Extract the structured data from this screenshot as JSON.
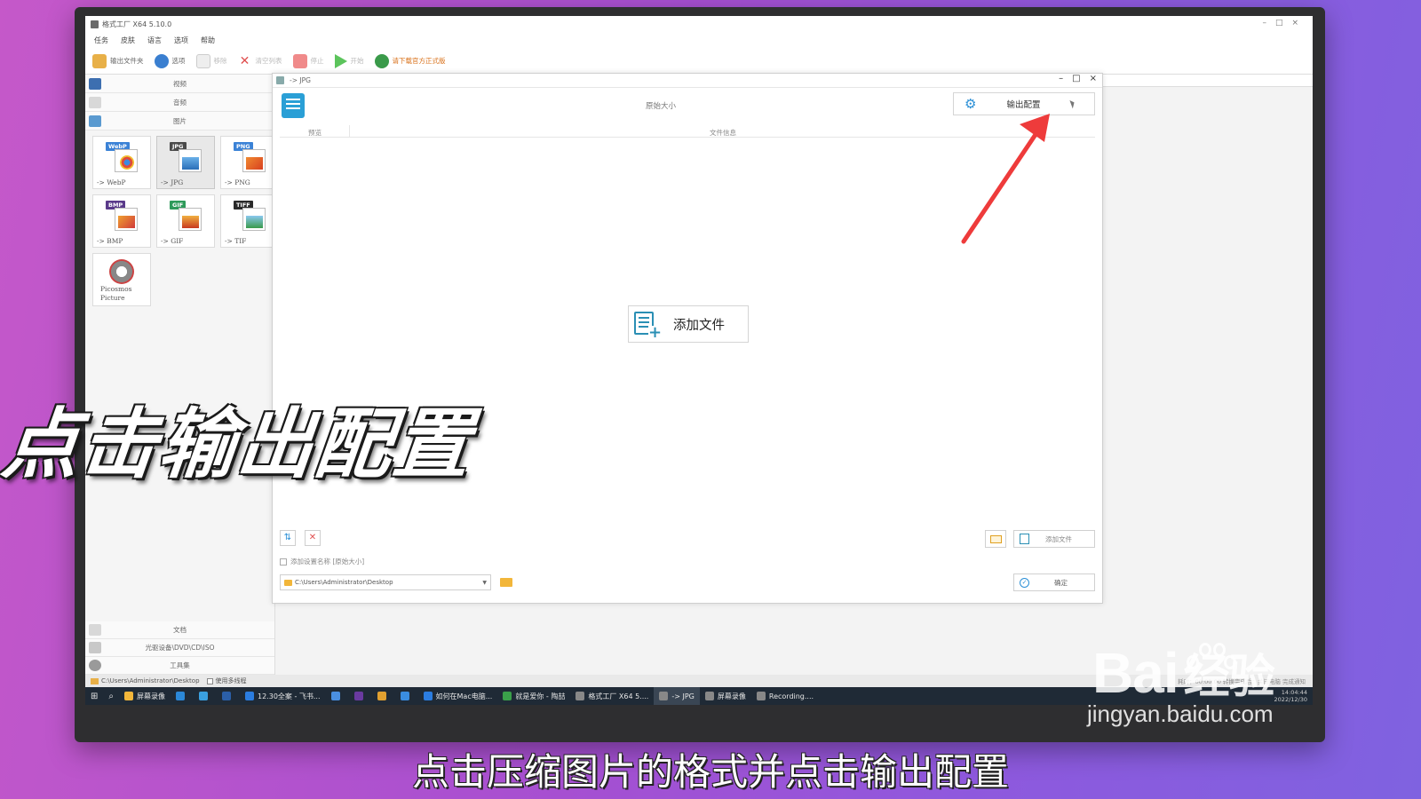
{
  "app": {
    "title": "格式工厂 X64 5.10.0",
    "menu": [
      "任务",
      "皮肤",
      "语言",
      "选项",
      "帮助"
    ],
    "toolbar": [
      {
        "label": "输出文件夹",
        "icon": "folder-icon",
        "dim": false
      },
      {
        "label": "选项",
        "icon": "options-icon",
        "dim": false
      },
      {
        "label": "移除",
        "icon": "remove-icon",
        "dim": true
      },
      {
        "label": "清空列表",
        "icon": "clear-list-icon",
        "dim": true
      },
      {
        "label": "停止",
        "icon": "stop-icon",
        "dim": true
      },
      {
        "label": "开始",
        "icon": "play-icon",
        "dim": true
      },
      {
        "label": "请下载官方正式版",
        "icon": "globe-icon",
        "dim": false
      }
    ],
    "sidebar": {
      "categories_top": [
        "视频",
        "音频",
        "图片"
      ],
      "formats": [
        {
          "label": "-> WebP",
          "badge": "WebP",
          "badge_color": "#3b82d6",
          "active": false
        },
        {
          "label": "-> JPG",
          "badge": "JPG",
          "badge_color": "#4a4a4a",
          "active": true
        },
        {
          "label": "-> PNG",
          "badge": "PNG",
          "badge_color": "#3b82d6",
          "active": false
        },
        {
          "label": "-> BMP",
          "badge": "BMP",
          "badge_color": "#5a3a8a",
          "active": false
        },
        {
          "label": "-> GIF",
          "badge": "GIF",
          "badge_color": "#2e9a5a",
          "active": false
        },
        {
          "label": "-> TIF",
          "badge": "TIFF",
          "badge_color": "#2a2a2a",
          "active": false
        }
      ],
      "picosmos": {
        "line1": "Picosmos",
        "line2": "Picture"
      },
      "categories_bottom": [
        "文档",
        "光驱设备\\DVD\\CD\\ISO",
        "工具集"
      ]
    },
    "statusbar": {
      "path": "C:\\Users\\Administrator\\Desktop",
      "multithread": "使用多线程",
      "right": "耗时：00:00:00   转换完成后：关闭电脑   完成通知"
    }
  },
  "dialog": {
    "title": "-> JPG",
    "size_label": "原始大小",
    "output_config": "输出配置",
    "col_preview": "预览",
    "col_fileinfo": "文件信息",
    "add_file": "添加文件",
    "add_file_small": "添加文件",
    "name_checkbox": "添加设置名称 [原始大小]",
    "output_path": "C:\\Users\\Administrator\\Desktop",
    "ok": "确定"
  },
  "taskbar": [
    {
      "label": "屏幕录像",
      "color": "#f2b63a",
      "active": false
    },
    {
      "label": "",
      "color": "#2b88d8",
      "active": false
    },
    {
      "label": "",
      "color": "#3aa0e0",
      "active": false
    },
    {
      "label": "",
      "color": "#2b5fa8",
      "active": false
    },
    {
      "label": "12.30全案 - 飞书...",
      "color": "#2b7de0",
      "active": false
    },
    {
      "label": "",
      "color": "#4a8fe0",
      "active": false
    },
    {
      "label": "",
      "color": "#6a3aa0",
      "active": false
    },
    {
      "label": "",
      "color": "#e0a030",
      "active": false
    },
    {
      "label": "",
      "color": "#3a8de0",
      "active": false
    },
    {
      "label": "如何在Mac电脑...",
      "color": "#2b7de0",
      "active": false
    },
    {
      "label": "就是爱你 - 陶喆",
      "color": "#3aa04a",
      "active": false
    },
    {
      "label": "格式工厂 X64 5....",
      "color": "#888888",
      "active": false
    },
    {
      "label": "-> JPG",
      "color": "#888888",
      "active": true
    },
    {
      "label": "屏幕录像",
      "color": "#888888",
      "active": false
    },
    {
      "label": "Recording....",
      "color": "#888888",
      "active": false
    }
  ],
  "taskbar_tray": {
    "time": "14:04:44",
    "date": "2022/12/30"
  },
  "overlay": {
    "caption": "点击输出配置",
    "subtitle": "点击压缩图片的格式并点击输出配置",
    "watermark_brand": "Bai",
    "watermark_cn": "经验",
    "watermark_url": "jingyan.baidu.com",
    "arrow_color": "#ee3b3b"
  }
}
